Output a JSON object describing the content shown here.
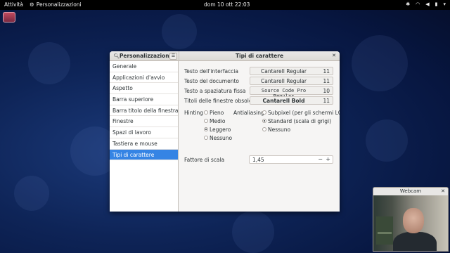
{
  "topbar": {
    "activities": "Attività",
    "app_name": "Personalizzazioni",
    "clock": "dom 10 ott  22:03"
  },
  "window": {
    "sidebar_title": "Personalizzazioni",
    "title": "Tipi di carattere",
    "sidebar_items": [
      "Generale",
      "Applicazioni d'avvio",
      "Aspetto",
      "Barra superiore",
      "Barra titolo della finestra",
      "Finestre",
      "Spazi di lavoro",
      "Tastiera e mouse",
      "Tipi di carattere"
    ],
    "active_item": "Tipi di carattere",
    "fonts": [
      {
        "label": "Testo dell'interfaccia",
        "font": "Cantarell Regular",
        "size": "11"
      },
      {
        "label": "Testo del documento",
        "font": "Cantarell Regular",
        "size": "11"
      },
      {
        "label": "Testo a spaziatura fissa",
        "font": "Source Code Pro Regular",
        "size": "10"
      },
      {
        "label": "Titoli delle finestre obsolete",
        "font": "Cantarell Bold",
        "size": "11"
      }
    ],
    "hinting": {
      "label": "Hinting",
      "options": [
        "Pieno",
        "Medio",
        "Leggero",
        "Nessuno"
      ],
      "selected": "Leggero"
    },
    "antialiasing": {
      "label": "Antialiasing",
      "options": [
        "Subpixel (per gli schermi LCD)",
        "Standard (scala di grigi)",
        "Nessuno"
      ],
      "selected": "Standard (scala di grigi)"
    },
    "scale": {
      "label": "Fattore di scala",
      "value": "1,45",
      "minus": "−",
      "plus": "+"
    }
  },
  "webcam": {
    "title": "Webcam"
  },
  "colors": {
    "accent": "#3584e4",
    "topbar": "#000000"
  }
}
